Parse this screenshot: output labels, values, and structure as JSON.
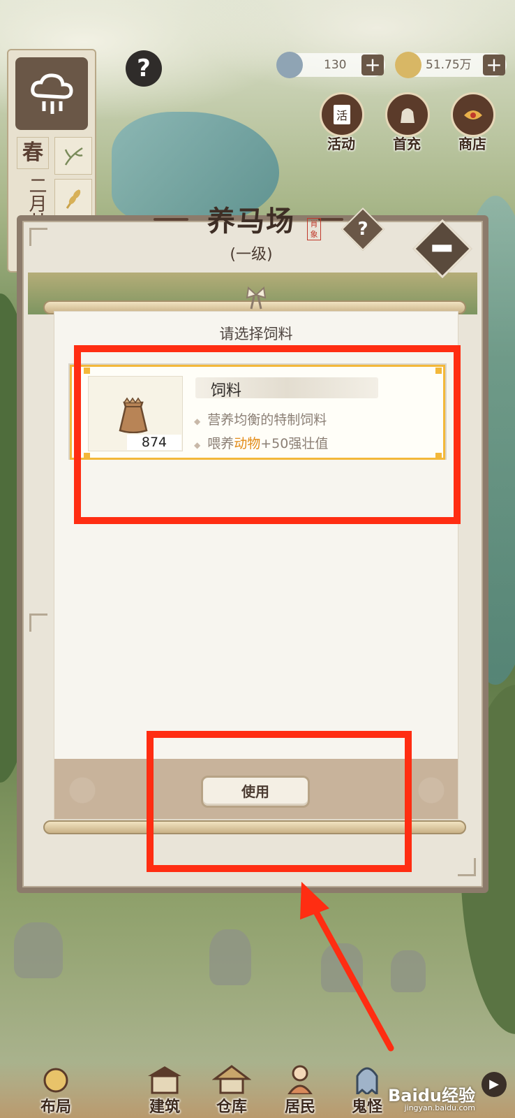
{
  "hud": {
    "season": "春",
    "month": "二月廿",
    "help_symbol": "?",
    "silver": "130",
    "coins": "51.75万",
    "plus": "+",
    "buttons": [
      {
        "icon": "calendar-icon",
        "label": "活动"
      },
      {
        "icon": "gift-bag-icon",
        "label": "首充"
      },
      {
        "icon": "shop-icon",
        "label": "商店"
      }
    ],
    "activity_icon_text": "活"
  },
  "panel": {
    "title": "养马场",
    "stamp": "肖象",
    "level": "(一级)",
    "help_symbol": "?"
  },
  "dialog": {
    "title": "请选择饲料",
    "item": {
      "name": "饲料",
      "count": "874",
      "desc1": "营养均衡的特制饲料",
      "desc2_prefix": "喂养",
      "desc2_highlight": "动物",
      "desc2_suffix": "+50强壮值",
      "bullet": "◆"
    },
    "use_button": "使用"
  },
  "colors": {
    "highlight": "#ff2d12",
    "card_border": "#f3b83a",
    "accent_text": "#e28b17"
  },
  "bottom_nav": [
    {
      "icon": "layout-icon",
      "label": "布局"
    },
    {
      "icon": "building-icon",
      "label": "建筑"
    },
    {
      "icon": "warehouse-icon",
      "label": "仓库"
    },
    {
      "icon": "residents-icon",
      "label": "居民"
    },
    {
      "icon": "ghost-icon",
      "label": "鬼怪"
    }
  ],
  "watermark": {
    "text": "Baidu经验",
    "sub": "jingyan.baidu.com"
  }
}
